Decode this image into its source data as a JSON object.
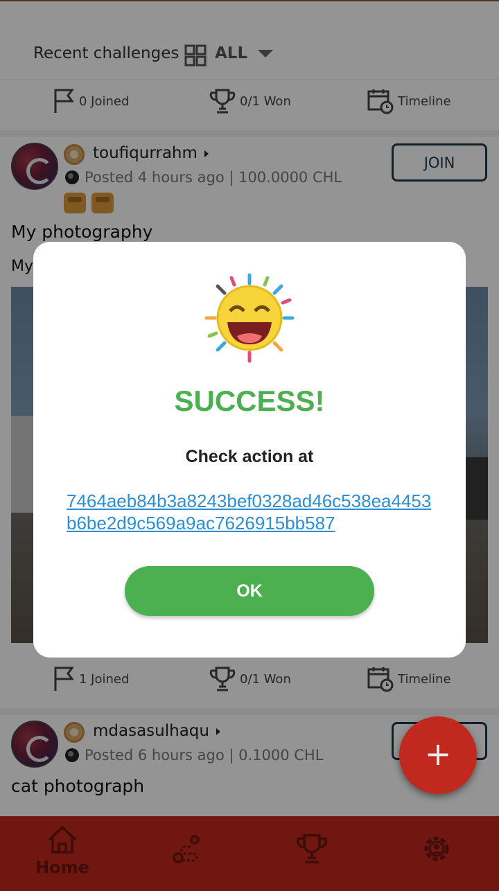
{
  "header": {
    "title": "Recent challenges",
    "filter_label": "ALL"
  },
  "stats_top": {
    "joined": "0 Joined",
    "won": "0/1 Won",
    "timeline": "Timeline"
  },
  "card1": {
    "username": "toufiqurrahm",
    "posted": "Posted 4 hours ago | 100.0000 CHL",
    "join_label": "JOIN",
    "title": "My photography",
    "desc_start": "My"
  },
  "stats_card1": {
    "joined": "1 Joined",
    "won": "0/1 Won",
    "timeline": "Timeline"
  },
  "card2": {
    "username": "mdasasulhaqu",
    "posted": "Posted 6 hours ago | 0.1000 CHL",
    "title": "cat photograph"
  },
  "fab_label": "+",
  "bottom_nav": {
    "home_label": "Home"
  },
  "dialog": {
    "title": "SUCCESS!",
    "message": "Check action at",
    "link": "7464aeb84b3a8243bef0328ad46c538ea4453b6be2d9c569a9ac7626915bb587",
    "ok_label": "OK"
  },
  "colors": {
    "success_green": "#4caf50",
    "brand_red": "#c1281e",
    "link_blue": "#2a8fd6"
  }
}
